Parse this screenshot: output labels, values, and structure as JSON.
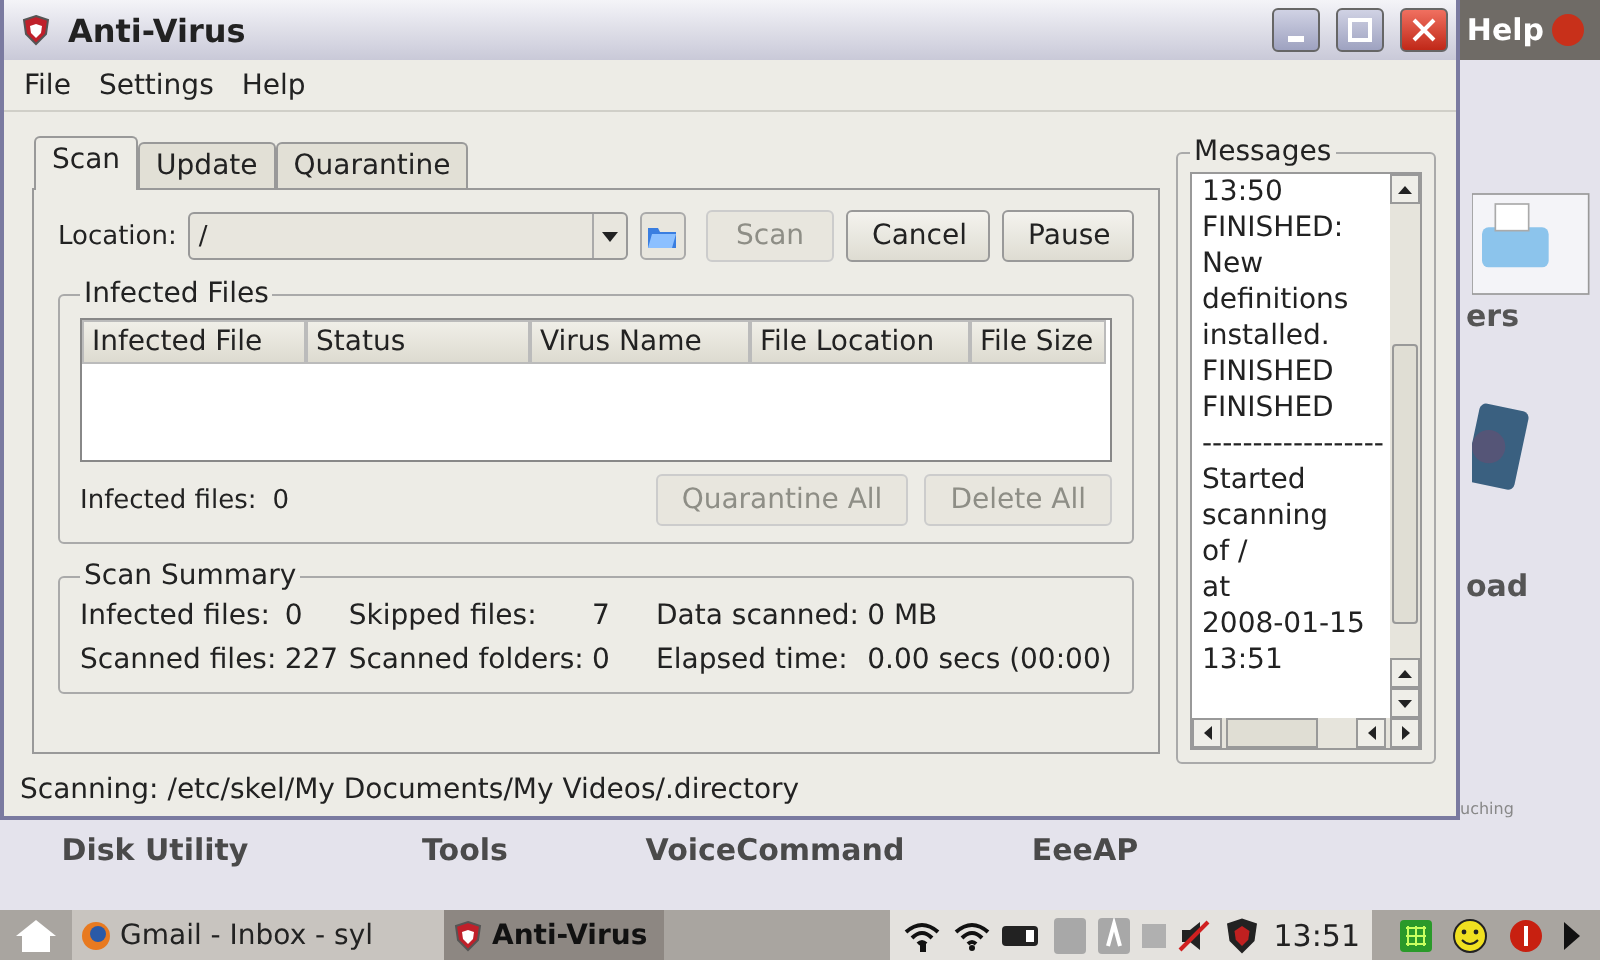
{
  "window": {
    "title": "Anti-Virus"
  },
  "menu": [
    "File",
    "Settings",
    "Help"
  ],
  "tabs": [
    {
      "label": "Scan",
      "selected": true
    },
    {
      "label": "Update",
      "selected": false
    },
    {
      "label": "Quarantine",
      "selected": false
    }
  ],
  "location": {
    "label": "Location:",
    "value": "/"
  },
  "buttons": [
    {
      "label": "Scan",
      "disabled": true
    },
    {
      "label": "Cancel",
      "disabled": false
    },
    {
      "label": "Pause",
      "disabled": false
    }
  ],
  "infected_files": {
    "title": "Infected Files",
    "columns": [
      "Infected File",
      "Status",
      "Virus Name",
      "File Location",
      "File Size"
    ],
    "count_label": "Infected files:",
    "count": "0",
    "buttons": [
      {
        "label": "Quarantine All",
        "disabled": true
      },
      {
        "label": "Delete All",
        "disabled": true
      }
    ]
  },
  "scan_summary": {
    "title": "Scan Summary",
    "items": [
      {
        "label": "Infected files:",
        "value": "0"
      },
      {
        "label": "Skipped files:",
        "value": "7"
      },
      {
        "label": "Data scanned:",
        "value": "0 MB"
      },
      {
        "label": "Scanned files:",
        "value": "227"
      },
      {
        "label": "Scanned folders:",
        "value": "0"
      },
      {
        "label": "Elapsed time:",
        "value": "0.00 secs (00:00)"
      }
    ]
  },
  "messages": {
    "title": "Messages",
    "lines": [
      "13:50",
      "FINISHED:",
      "New",
      "definitions",
      "installed.",
      "FINISHED",
      "FINISHED",
      "------------------",
      "Started",
      "scanning",
      "of /",
      "at",
      "2008-01-15",
      "13:51"
    ]
  },
  "status": "Scanning: /etc/skel/My Documents/My Videos/.directory",
  "desktop": {
    "help": "Help",
    "icon_labels": [
      "ers",
      "oad"
    ],
    "tagline": "uching",
    "labels": [
      "Disk Utility",
      "Tools",
      "VoiceCommand",
      "EeeAP"
    ]
  },
  "taskbar": {
    "tasks": [
      {
        "label": "Gmail - Inbox - syl",
        "selected": false
      },
      {
        "label": "Anti-Virus",
        "selected": true
      }
    ],
    "clock": "13:51"
  }
}
